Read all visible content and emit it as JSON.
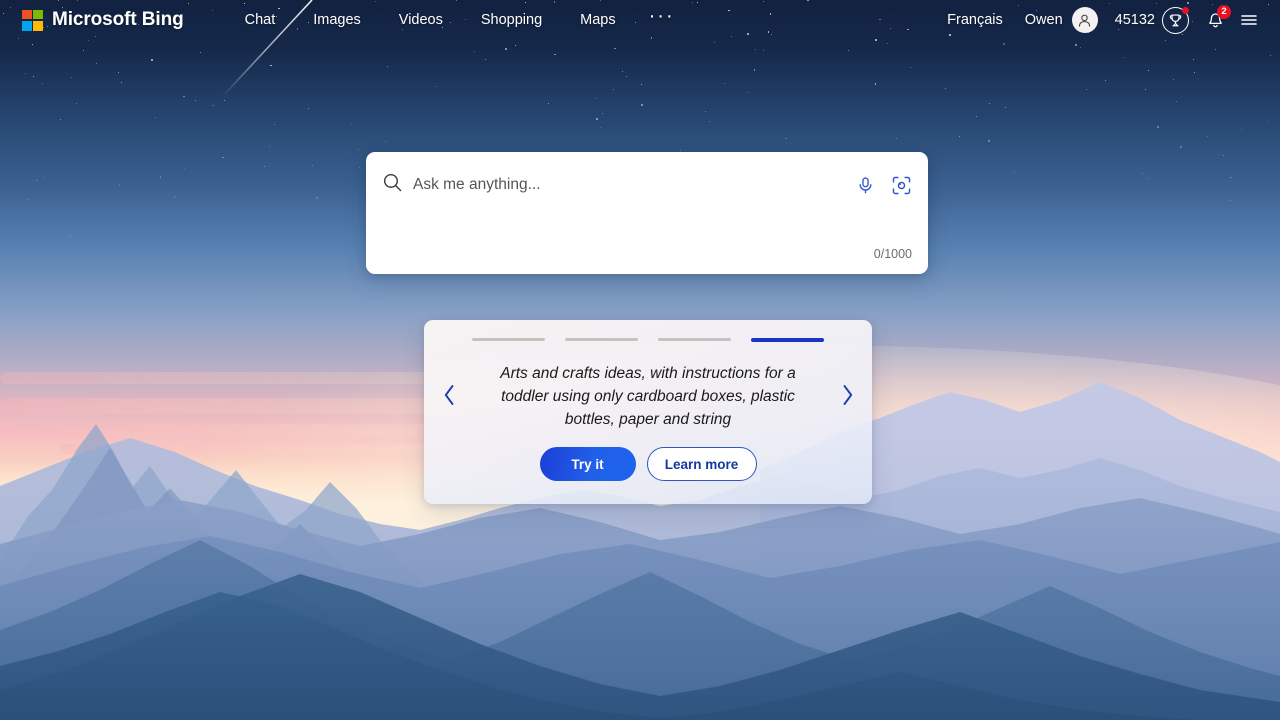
{
  "header": {
    "brand": "Microsoft Bing",
    "logo_colors": {
      "top_left": "#f25022",
      "top_right": "#7fba00",
      "bottom_left": "#00a4ef",
      "bottom_right": "#ffb900"
    },
    "nav": [
      {
        "label": "Chat",
        "name": "nav-chat"
      },
      {
        "label": "Images",
        "name": "nav-images"
      },
      {
        "label": "Videos",
        "name": "nav-videos"
      },
      {
        "label": "Shopping",
        "name": "nav-shopping"
      },
      {
        "label": "Maps",
        "name": "nav-maps"
      }
    ],
    "more_label": "···",
    "language": "Français",
    "user_name": "Owen",
    "rewards_points": "45132",
    "notifications_badge": "2",
    "icons": {
      "avatar": "person-icon",
      "rewards": "trophy-icon",
      "notifications": "bell-icon",
      "menu": "hamburger-menu-icon"
    }
  },
  "search": {
    "placeholder": "Ask me anything...",
    "value": "",
    "counter": "0/1000",
    "icons": {
      "search": "search-icon",
      "mic": "microphone-icon",
      "visual": "visual-search-icon"
    },
    "accent": "#2f55c9"
  },
  "carousel": {
    "total_slides": 4,
    "active_slide": 4,
    "active_color": "#1b34c4",
    "inactive_color": "#c6c2c0",
    "prompt": "Arts and crafts ideas, with instructions for a toddler using only cardboard boxes, plastic bottles, paper and string",
    "primary_button": "Try it",
    "secondary_button": "Learn more",
    "prev_label": "‹",
    "next_label": "›",
    "primary_color": "#2160e8",
    "secondary_text_color": "#13399e"
  },
  "background": {
    "scene": "sunset-mountain-landscape",
    "sky_top": "#13223e",
    "sky_mid": "#5b86b4",
    "sky_glow": "#f7cfc6",
    "sky_pink": "#f4b9be",
    "mountain_far": "#b9c2e0",
    "mountain_mid": "#7f97c2",
    "mountain_near": "#4a6d99",
    "mountain_dark": "#3c5e86"
  }
}
